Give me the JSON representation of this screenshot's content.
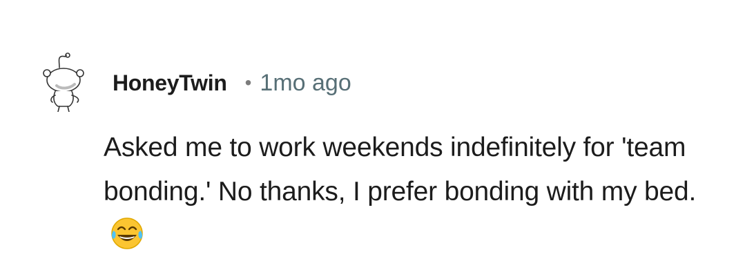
{
  "comment": {
    "username": "HoneyTwin",
    "separator": "•",
    "timestamp": "1mo ago",
    "text": "Asked me to work weekends indefinitely for 'team bonding.' No thanks, I prefer bonding with my bed.",
    "emoji_icon": "face-with-tears-of-joy-icon",
    "avatar_icon": "snoo-avatar-icon"
  },
  "colors": {
    "username": "#1c1c1c",
    "timestamp": "#576f76",
    "body_text": "#1c1c1c",
    "background": "#ffffff"
  }
}
